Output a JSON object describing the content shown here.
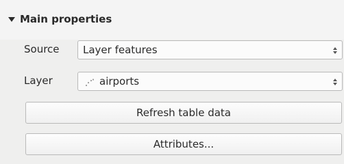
{
  "group": {
    "title": "Main properties",
    "toggle_icon": "triangle-down-icon"
  },
  "source": {
    "label": "Source",
    "value": "Layer features"
  },
  "layer": {
    "label": "Layer",
    "value": "airports",
    "layer_icon": "point-layer-icon"
  },
  "buttons": {
    "refresh_label": "Refresh table data",
    "attributes_label": "Attributes..."
  }
}
